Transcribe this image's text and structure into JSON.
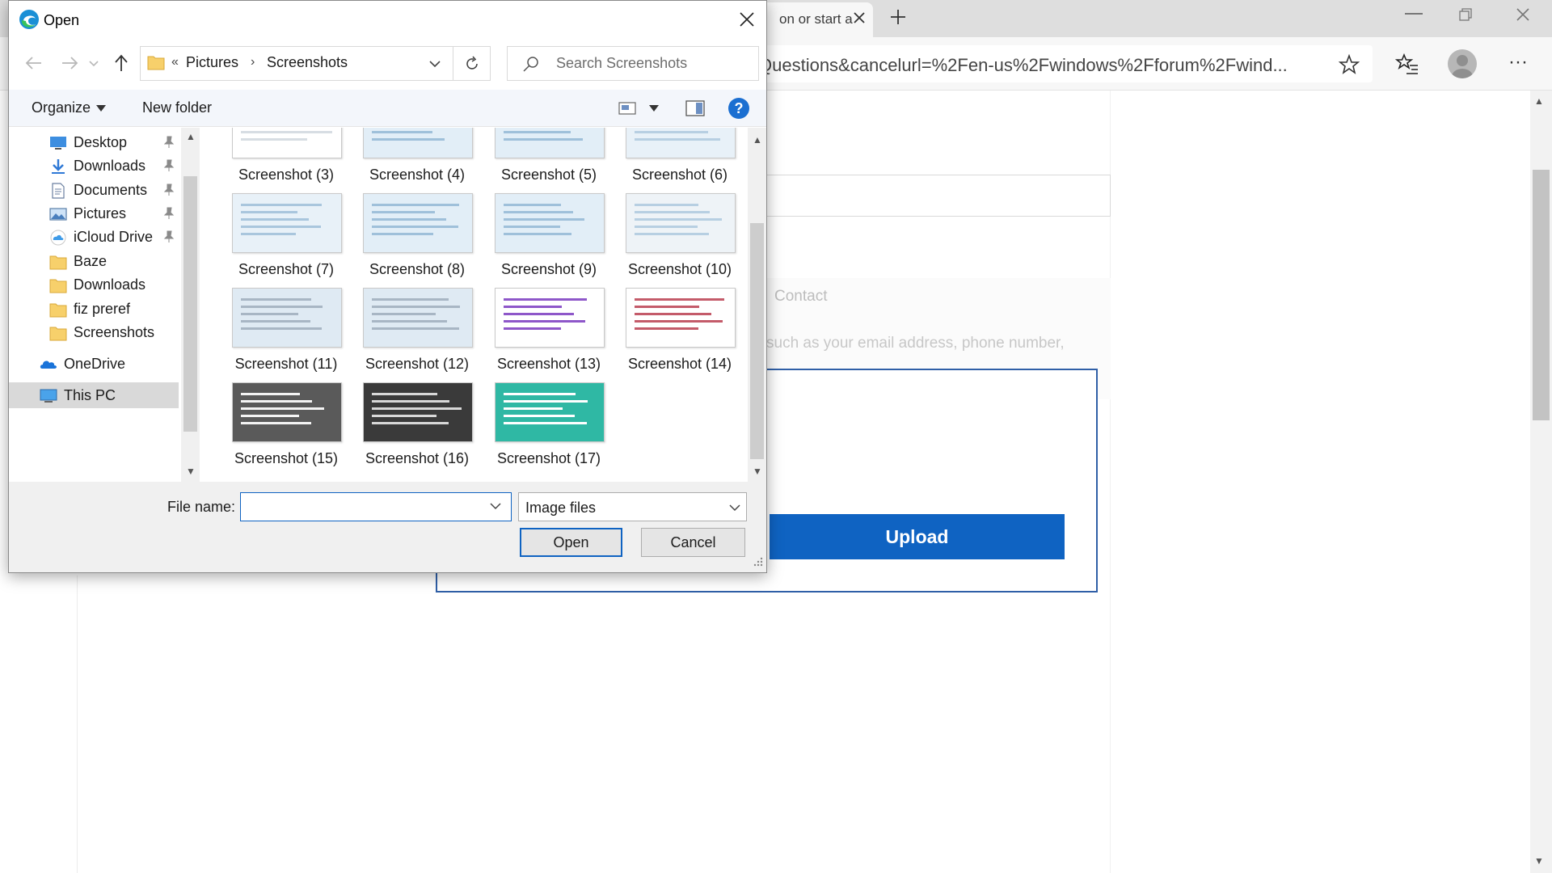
{
  "browser": {
    "tab_title": "on or start a",
    "address": "Questions&cancelurl=%2Fen-us%2Fwindows%2Fforum%2Fwind...",
    "icons": {
      "tab_close": "close-icon",
      "new_tab": "plus-icon",
      "favorite": "star-icon",
      "favorites": "favorites-icon",
      "more": "more-icon"
    }
  },
  "page": {
    "contact_label": "Contact",
    "hint_text": "such as your email address, phone number,",
    "upload_button": "Upload",
    "accent": "#0f63c2"
  },
  "dialog": {
    "title": "Open",
    "breadcrumb": {
      "overflow": "«",
      "parts": [
        "Pictures",
        "Screenshots"
      ]
    },
    "search_placeholder": "Search Screenshots",
    "toolbar": {
      "organize": "Organize",
      "new_folder": "New folder",
      "help": "?"
    },
    "nav_items": [
      {
        "label": "Desktop",
        "icon": "desktop-icon",
        "pinned": true
      },
      {
        "label": "Downloads",
        "icon": "download-icon",
        "pinned": true
      },
      {
        "label": "Documents",
        "icon": "documents-icon",
        "pinned": true
      },
      {
        "label": "Pictures",
        "icon": "pictures-icon",
        "pinned": true
      },
      {
        "label": "iCloud Drive",
        "icon": "icloud-icon",
        "pinned": true
      },
      {
        "label": "Baze",
        "icon": "folder-icon",
        "pinned": false
      },
      {
        "label": "Downloads",
        "icon": "folder-icon",
        "pinned": false
      },
      {
        "label": "fiz preref",
        "icon": "folder-icon",
        "pinned": false
      },
      {
        "label": "Screenshots",
        "icon": "folder-icon",
        "pinned": false
      },
      {
        "label": "OneDrive",
        "icon": "onedrive-icon",
        "pinned": false
      },
      {
        "label": "This PC",
        "icon": "this-pc-icon",
        "pinned": false,
        "selected": true
      }
    ],
    "files": [
      "Screenshot (3)",
      "Screenshot (4)",
      "Screenshot (5)",
      "Screenshot (6)",
      "Screenshot (7)",
      "Screenshot (8)",
      "Screenshot (9)",
      "Screenshot (10)",
      "Screenshot (11)",
      "Screenshot (12)",
      "Screenshot (13)",
      "Screenshot (14)",
      "Screenshot (15)",
      "Screenshot (16)",
      "Screenshot (17)"
    ],
    "file_name_label": "File name:",
    "file_name_value": "",
    "file_type": "Image files",
    "open_button": "Open",
    "cancel_button": "Cancel"
  }
}
